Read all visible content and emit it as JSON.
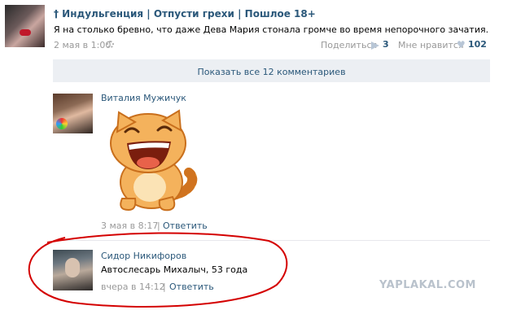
{
  "post": {
    "group_name": "† Индульгенция | Отпусти грехи | Пошлое 18+",
    "text": "Я на столько бревно, что даже Дева Мария стонала громче во время непорочного зачатия.",
    "date": "2 мая в 1:00",
    "share_label": "Поделиться",
    "share_count": "3",
    "like_label": "Мне нравится",
    "like_count": "102"
  },
  "show_all_comments": "Показать все 12 комментариев",
  "comments": [
    {
      "author": "Виталия Мужичук",
      "date": "3 мая в 8:17",
      "reply": "Ответить"
    },
    {
      "author": "Сидор Никифоров",
      "text": "Автослесарь Михалыч, 53 года",
      "date": "вчера в 14:12",
      "reply": "Ответить"
    }
  ],
  "watermark": "YAPLAKAL.COM",
  "colors": {
    "link": "#2b587a",
    "button_bg": "#eceff3",
    "annotation_red": "#d40000"
  }
}
